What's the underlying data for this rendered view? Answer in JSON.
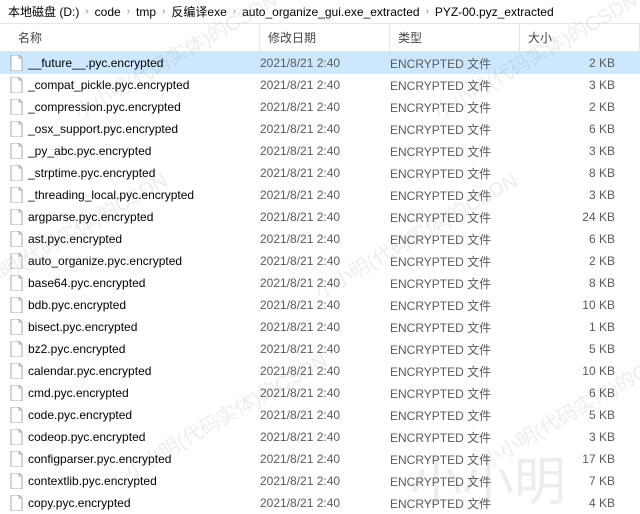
{
  "breadcrumb": [
    "本地磁盘 (D:)",
    "code",
    "tmp",
    "反编译exe",
    "auto_organize_gui.exe_extracted",
    "PYZ-00.pyz_extracted"
  ],
  "columns": {
    "name": "名称",
    "date": "修改日期",
    "type": "类型",
    "size": "大小"
  },
  "type_label": "ENCRYPTED 文件",
  "date_value": "2021/8/21 2:40",
  "files": [
    {
      "name": "__future__.pyc.encrypted",
      "size": "2 KB",
      "selected": true
    },
    {
      "name": "_compat_pickle.pyc.encrypted",
      "size": "3 KB"
    },
    {
      "name": "_compression.pyc.encrypted",
      "size": "2 KB"
    },
    {
      "name": "_osx_support.pyc.encrypted",
      "size": "6 KB"
    },
    {
      "name": "_py_abc.pyc.encrypted",
      "size": "3 KB"
    },
    {
      "name": "_strptime.pyc.encrypted",
      "size": "8 KB"
    },
    {
      "name": "_threading_local.pyc.encrypted",
      "size": "3 KB"
    },
    {
      "name": "argparse.pyc.encrypted",
      "size": "24 KB"
    },
    {
      "name": "ast.pyc.encrypted",
      "size": "6 KB"
    },
    {
      "name": "auto_organize.pyc.encrypted",
      "size": "2 KB"
    },
    {
      "name": "base64.pyc.encrypted",
      "size": "8 KB"
    },
    {
      "name": "bdb.pyc.encrypted",
      "size": "10 KB"
    },
    {
      "name": "bisect.pyc.encrypted",
      "size": "1 KB"
    },
    {
      "name": "bz2.pyc.encrypted",
      "size": "5 KB"
    },
    {
      "name": "calendar.pyc.encrypted",
      "size": "10 KB"
    },
    {
      "name": "cmd.pyc.encrypted",
      "size": "6 KB"
    },
    {
      "name": "code.pyc.encrypted",
      "size": "5 KB"
    },
    {
      "name": "codeop.pyc.encrypted",
      "size": "3 KB"
    },
    {
      "name": "configparser.pyc.encrypted",
      "size": "17 KB"
    },
    {
      "name": "contextlib.pyc.encrypted",
      "size": "7 KB"
    },
    {
      "name": "copy.pyc.encrypted",
      "size": "4 KB"
    }
  ]
}
